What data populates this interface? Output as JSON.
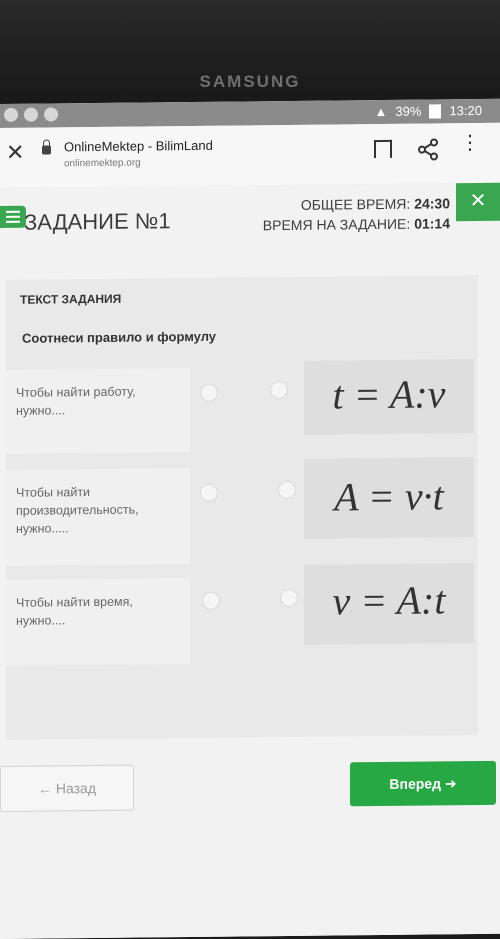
{
  "device": {
    "brand": "SAMSUNG"
  },
  "status_bar": {
    "battery": "39%",
    "time": "13:20"
  },
  "browser": {
    "site_title": "OnlineMektep - BilimLand",
    "site_url": "onlinemektep.org"
  },
  "task": {
    "title": "ЗАДАНИЕ №1",
    "total_time_label": "ОБЩЕЕ ВРЕМЯ:",
    "total_time_value": "24:30",
    "task_time_label": "ВРЕМЯ НА ЗАДАНИЕ:",
    "task_time_value": "01:14",
    "text_label": "ТЕКСТ ЗАДАНИЯ",
    "question": "Соотнеси правило и формулу",
    "left_items": [
      "Чтобы найти работу, нужно....",
      "Чтобы найти производительность, нужно.....",
      "Чтобы найти время, нужно...."
    ],
    "formulas": [
      "t = A:v",
      "A = v·t",
      "v = A:t"
    ]
  },
  "nav": {
    "back_label": "Назад",
    "next_label": "Вперед"
  },
  "colors": {
    "accent": "#28a745",
    "formula_bg": "#dedede"
  }
}
